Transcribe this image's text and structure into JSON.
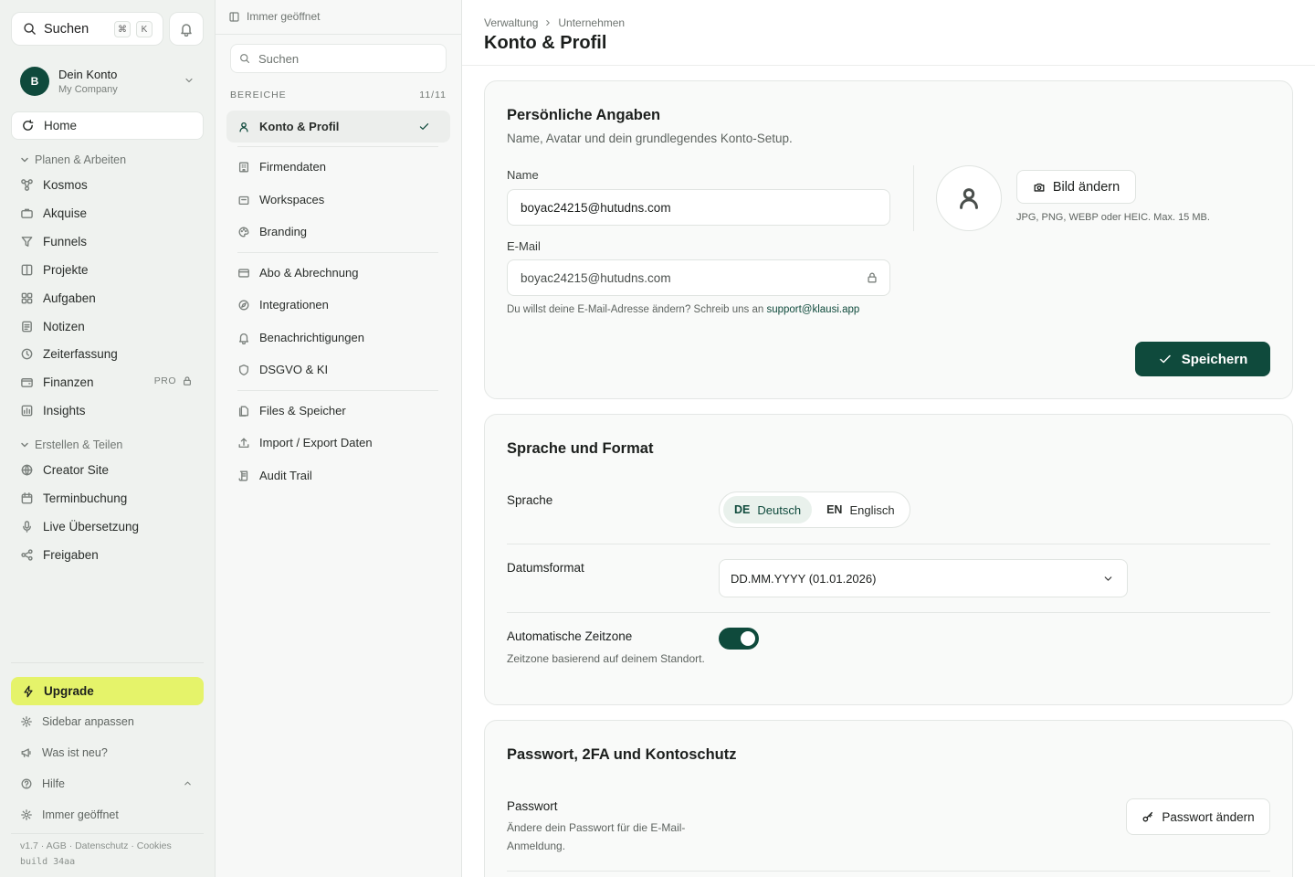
{
  "sidebar": {
    "search_label": "Suchen",
    "kbd_cmd": "⌘",
    "kbd_k": "K",
    "account": {
      "initial": "B",
      "name": "Dein Konto",
      "company": "My Company"
    },
    "home_label": "Home",
    "group1_label": "Planen & Arbeiten",
    "group1_items": [
      "Kosmos",
      "Akquise",
      "Funnels",
      "Projekte",
      "Aufgaben",
      "Notizen",
      "Zeiterfassung",
      "Finanzen",
      "Insights"
    ],
    "pro_badge": "PRO",
    "group2_label": "Erstellen & Teilen",
    "group2_items": [
      "Creator Site",
      "Terminbuchung",
      "Live Übersetzung",
      "Freigaben"
    ],
    "upgrade_label": "Upgrade",
    "footer_items": [
      "Sidebar anpassen",
      "Was ist neu?",
      "Hilfe",
      "Immer geöffnet"
    ],
    "legal": "v1.7 · AGB · Datenschutz · Cookies",
    "build": "build 34aa"
  },
  "midpanel": {
    "header": "Immer geöffnet",
    "search_placeholder": "Suchen",
    "section_label": "BEREICHE",
    "section_count": "11/11",
    "items": [
      "Konto & Profil",
      "Firmendaten",
      "Workspaces",
      "Branding",
      "Abo & Abrechnung",
      "Integrationen",
      "Benachrichtigungen",
      "DSGVO & KI",
      "Files & Speicher",
      "Import / Export Daten",
      "Audit Trail"
    ]
  },
  "main": {
    "breadcrumb": [
      "Verwaltung",
      "Unternehmen"
    ],
    "title": "Konto & Profil",
    "personal": {
      "title": "Persönliche Angaben",
      "subtitle": "Name, Avatar und dein grundlegendes Konto-Setup.",
      "name_label": "Name",
      "name_value": "boyac24215@hutudns.com",
      "email_label": "E-Mail",
      "email_value": "boyac24215@hutudns.com",
      "email_hint": "Du willst deine E-Mail-Adresse ändern? Schreib uns an ",
      "email_hint_link": "support@klausi.app",
      "change_image_label": "Bild ändern",
      "image_hint": "JPG, PNG, WEBP oder HEIC. Max. 15 MB.",
      "save_label": "Speichern"
    },
    "language": {
      "title": "Sprache und Format",
      "language_label": "Sprache",
      "options": [
        {
          "code": "DE",
          "label": "Deutsch",
          "selected": true
        },
        {
          "code": "EN",
          "label": "Englisch",
          "selected": false
        }
      ],
      "date_label": "Datumsformat",
      "date_value": "DD.MM.YYYY (01.01.2026)",
      "tz_label": "Automatische Zeitzone",
      "tz_desc": "Zeitzone basierend auf deinem Standort.",
      "tz_enabled": true
    },
    "security": {
      "title": "Passwort, 2FA und Kontoschutz",
      "password_label": "Passwort",
      "password_desc": "Ändere dein Passwort für die E-Mail-Anmeldung.",
      "change_password_label": "Passwort ändern"
    }
  },
  "colors": {
    "brand": "#0f4a3c",
    "upgrade": "#e5f36a",
    "sidebar_bg": "#eff2ef"
  }
}
